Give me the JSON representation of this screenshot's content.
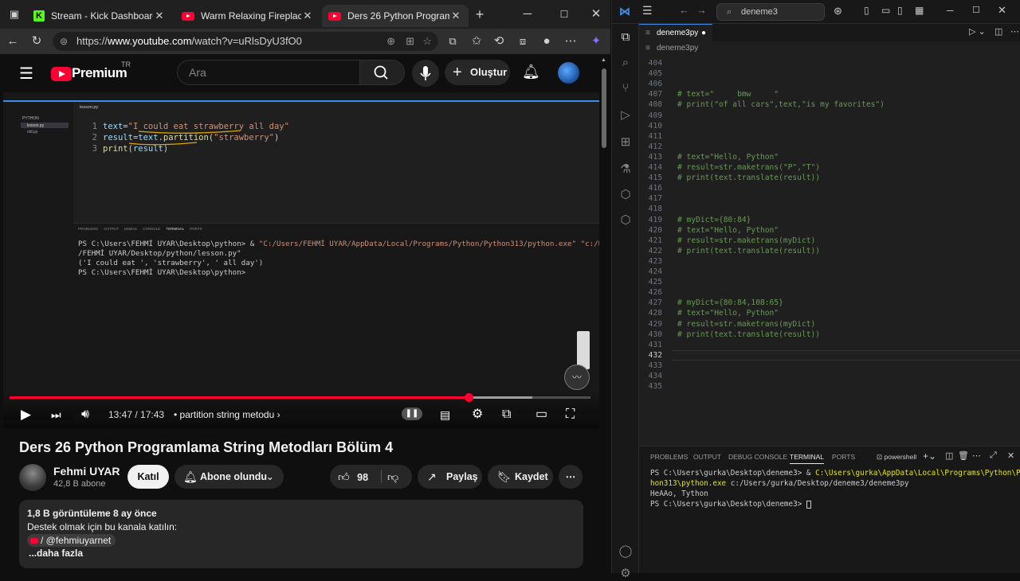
{
  "browser": {
    "tabs": [
      {
        "title": "Stream - Kick Dashboard",
        "icon": "kick-icon"
      },
      {
        "title": "Warm Relaxing Fireplace ~ Bu",
        "icon": "youtube-icon"
      },
      {
        "title": "Ders 26 Python Programlama",
        "icon": "youtube-icon"
      }
    ],
    "url_prefix": "https://",
    "url_host": "www.youtube.com",
    "url_path": "/watch?v=uRlsDyU3fO0"
  },
  "youtube": {
    "logo": "Premium",
    "region": "TR",
    "search_placeholder": "Ara",
    "create_label": "Oluştur"
  },
  "video": {
    "inner_editor_lines": [
      {
        "n": "1",
        "code": "text=\"I could eat strawberry all day\""
      },
      {
        "n": "2",
        "code": "result=text.partition(\"strawberry\")"
      },
      {
        "n": "3",
        "code": "print(result)"
      }
    ],
    "inner_tab": "lesson.py",
    "inner_side_folder": "PYTHON",
    "inner_side_files": [
      "lesson.py",
      "old.py"
    ],
    "inner_panel_tabs": [
      "PROBLEMS",
      "OUTPUT",
      "DEBUG CONSOLE",
      "TERMINAL",
      "PORTS"
    ],
    "inner_terminal": [
      "PS C:\\Users\\FEHMİ UYAR\\Desktop\\python> & \"C:/Users/FEHMİ UYAR/AppData/Local/Programs/Python/Python313/python.exe\" \"c:/Users",
      "/FEHMİ UYAR/Desktop/python/lesson.py\"",
      "('I could eat ', 'strawberry', ' all day')",
      "PS C:\\Users\\FEHMİ UYAR\\Desktop\\python>"
    ],
    "current_time": "13:47",
    "duration": "17:43",
    "chapter": "partition string metodu",
    "progress_fraction": 0.79,
    "buffered_fraction": 0.9
  },
  "meta": {
    "title": "Ders 26 Python Programlama String Metodları Bölüm 4",
    "channel": "Fehmi UYAR",
    "subscribers": "42,8 B abone",
    "join_label": "Katıl",
    "subscribed_label": "Abone olundu",
    "likes": "98",
    "share_label": "Paylaş",
    "save_label": "Kaydet",
    "views_line": "1,8 B görüntüleme  8 ay önce",
    "desc_line": "Destek olmak için bu kanala katılın:",
    "handle": "/ @fehmiuyarnet",
    "more_label": "...daha fazla"
  },
  "vscode": {
    "command_center": "deneme3",
    "tab_title": "deneme3py",
    "breadcrumb": "deneme3py",
    "lines": [
      {
        "n": "404",
        "code": ""
      },
      {
        "n": "405",
        "code": ""
      },
      {
        "n": "406",
        "code": ""
      },
      {
        "n": "407",
        "code": "# text=\"     bmw     \""
      },
      {
        "n": "408",
        "code": "# print(\"of all cars\",text,\"is my favorites\")"
      },
      {
        "n": "409",
        "code": ""
      },
      {
        "n": "410",
        "code": ""
      },
      {
        "n": "411",
        "code": ""
      },
      {
        "n": "412",
        "code": ""
      },
      {
        "n": "413",
        "code": "# text=\"Hello, Python\""
      },
      {
        "n": "414",
        "code": "# result=str.maketrans(\"P\",\"T\")"
      },
      {
        "n": "415",
        "code": "# print(text.translate(result))"
      },
      {
        "n": "416",
        "code": ""
      },
      {
        "n": "417",
        "code": ""
      },
      {
        "n": "418",
        "code": ""
      },
      {
        "n": "419",
        "code": "# myDict={80:84}"
      },
      {
        "n": "420",
        "code": "# text=\"Hello, Python\""
      },
      {
        "n": "421",
        "code": "# result=str.maketrans(myDict)"
      },
      {
        "n": "422",
        "code": "# print(text.translate(result))"
      },
      {
        "n": "423",
        "code": ""
      },
      {
        "n": "424",
        "code": ""
      },
      {
        "n": "425",
        "code": ""
      },
      {
        "n": "426",
        "code": ""
      },
      {
        "n": "427",
        "code": "# myDict={80:84,108:65}"
      },
      {
        "n": "428",
        "code": "# text=\"Hello, Python\""
      },
      {
        "n": "429",
        "code": "# result=str.maketrans(myDict)"
      },
      {
        "n": "430",
        "code": "# print(text.translate(result))"
      },
      {
        "n": "431",
        "code": ""
      },
      {
        "n": "432",
        "code": ""
      },
      {
        "n": "433",
        "code": ""
      },
      {
        "n": "434",
        "code": ""
      },
      {
        "n": "435",
        "code": ""
      }
    ],
    "panel_tabs": [
      "PROBLEMS",
      "OUTPUT",
      "DEBUG CONSOLE",
      "TERMINAL",
      "PORTS"
    ],
    "shell_label": "powershell",
    "terminal_prompt1": "PS C:\\Users\\gurka\\Desktop\\deneme3> & ",
    "terminal_exe1": "C:\\Users\\gurka\\AppData\\Local\\Programs\\Python\\Pyt",
    "terminal_exe2": "hon313\\python.exe",
    "terminal_arg": " c:/Users/gurka/Desktop/deneme3/deneme3py",
    "terminal_output": "HeAAo, Tython",
    "terminal_prompt2": "PS C:\\Users\\gurka\\Desktop\\deneme3> "
  },
  "colors": {
    "accent": "#ff0033",
    "vscode_blue": "#3b8ee8",
    "comment": "#6a9955"
  }
}
